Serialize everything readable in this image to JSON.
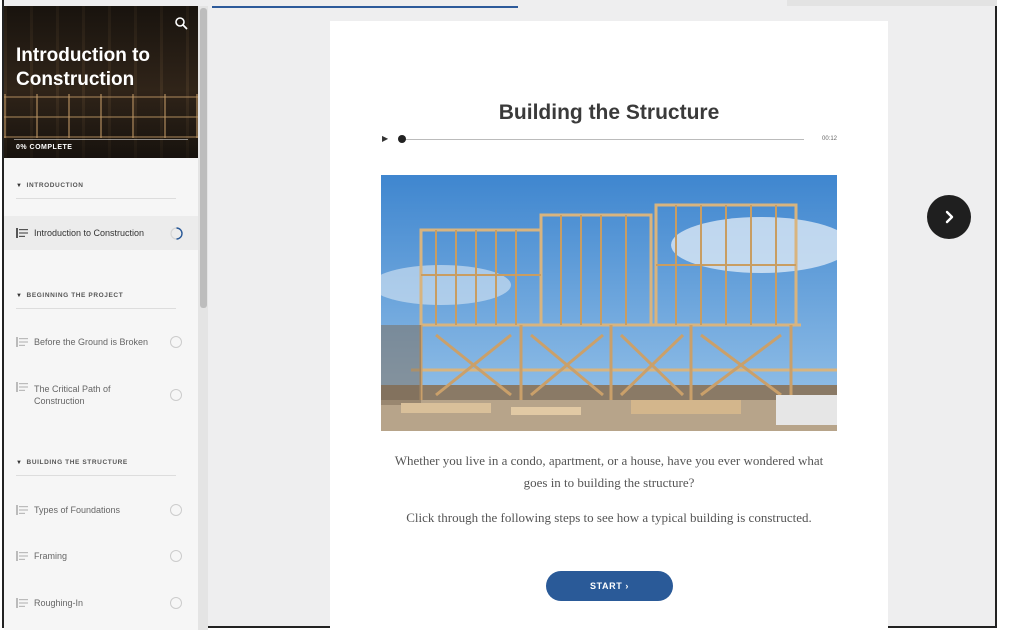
{
  "course": {
    "title": "Introduction to Construction",
    "progress_label": "0% COMPLETE",
    "progress_fraction": 0
  },
  "sidebar": {
    "sections": [
      {
        "heading": "INTRODUCTION",
        "items": [
          {
            "label": "Introduction to Construction",
            "state": "in-progress"
          }
        ]
      },
      {
        "heading": "BEGINNING THE PROJECT",
        "items": [
          {
            "label": "Before the Ground is Broken",
            "state": "not-started"
          },
          {
            "label": "The Critical Path of Construction",
            "state": "not-started"
          }
        ]
      },
      {
        "heading": "BUILDING THE STRUCTURE",
        "items": [
          {
            "label": "Types of Foundations",
            "state": "not-started"
          },
          {
            "label": "Framing",
            "state": "not-started"
          },
          {
            "label": "Roughing-In",
            "state": "not-started"
          }
        ]
      }
    ]
  },
  "lesson": {
    "title": "Building the Structure",
    "audio": {
      "time": "00:12",
      "progress_fraction": 0.02
    },
    "paragraph_1": "Whether you live in a condo, apartment, or a house, have you ever wondered what goes in to building the structure?",
    "paragraph_2": "Click through the following steps to see how a typical building is constructed.",
    "start_label": "START ›"
  },
  "icons": {
    "search": "search-icon",
    "next": "chevron-right-icon",
    "play": "play-icon",
    "lesson": "lesson-lines-icon",
    "status": "status-circle-icon"
  },
  "colors": {
    "accent": "#2a5a98",
    "next_button": "#1f1f1f",
    "hero_text": "#ffffff"
  }
}
